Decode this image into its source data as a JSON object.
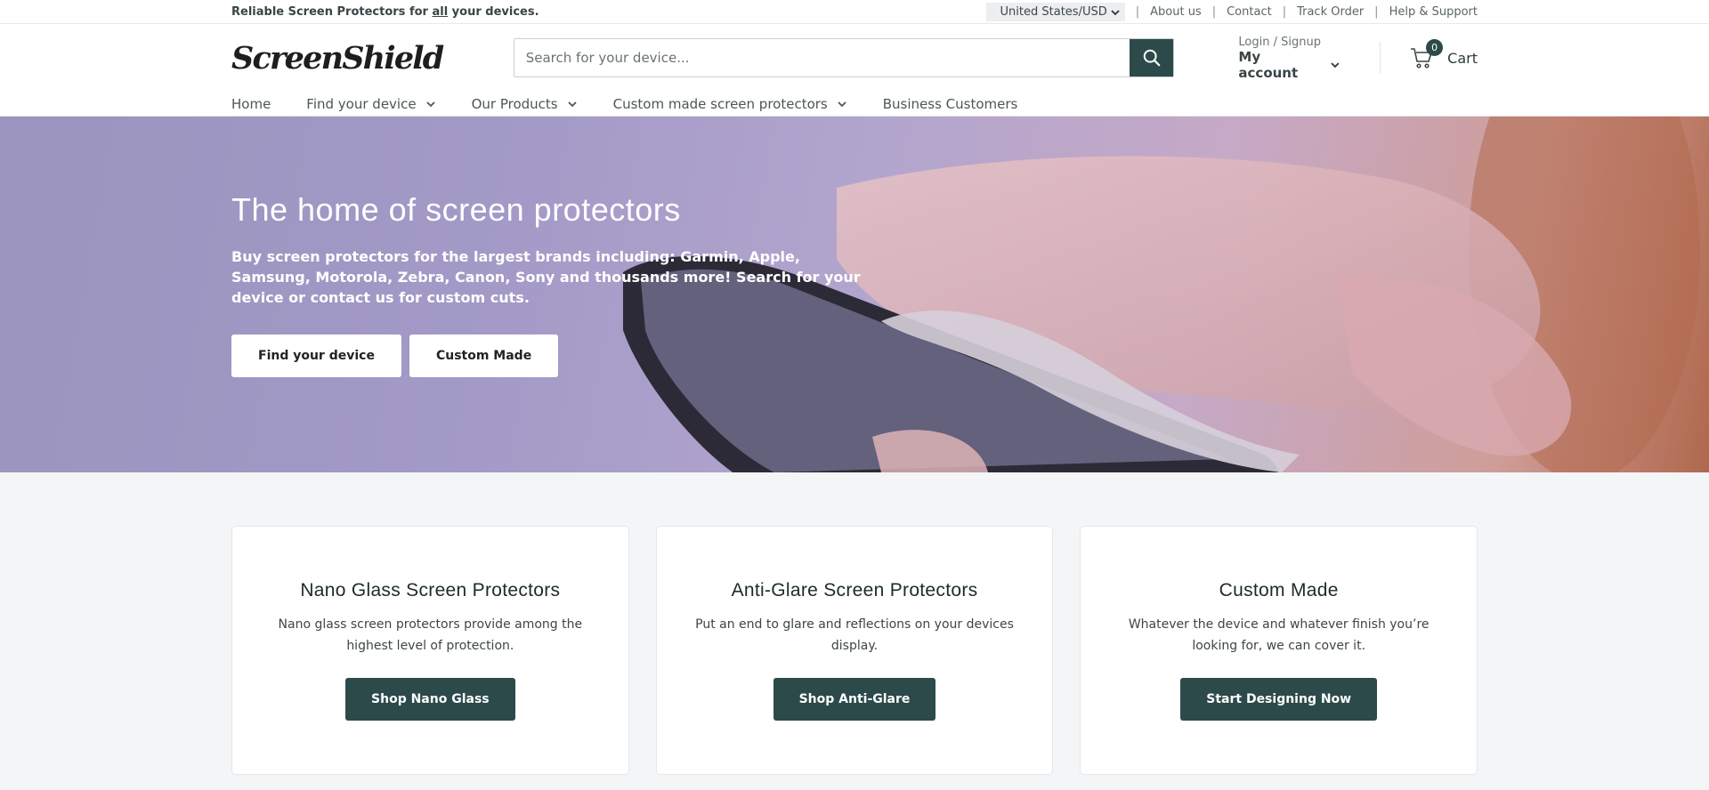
{
  "topbar": {
    "tagline_prefix": "Reliable Screen Protectors for ",
    "tagline_emph": "all",
    "tagline_suffix": " your devices.",
    "currency": "United States/USD",
    "links": [
      "About us",
      "Contact",
      "Track Order",
      "Help & Support"
    ]
  },
  "header": {
    "logo": "ScreenShield",
    "search_placeholder": "Search for your device...",
    "account_small": "Login / Signup",
    "account_big": "My account",
    "cart_count": "0",
    "cart_label": "Cart"
  },
  "nav": {
    "items": [
      {
        "label": "Home"
      },
      {
        "label": "Find your device"
      },
      {
        "label": "Our Products"
      },
      {
        "label": "Custom made screen protectors"
      },
      {
        "label": "Business Customers"
      }
    ]
  },
  "hero": {
    "title": "The home of screen protectors",
    "text": "Buy screen protectors for the largest brands including: Garmin, Apple, Samsung, Motorola, Zebra, Canon, Sony and thousands more! Search for your device or contact us for custom cuts.",
    "btn_find": "Find your device",
    "btn_custom": "Custom Made"
  },
  "cards": [
    {
      "title": "Nano Glass Screen Protectors",
      "text": "Nano glass screen protectors provide among the highest level of protection.",
      "button": "Shop Nano Glass"
    },
    {
      "title": "Anti-Glare Screen Protectors",
      "text": "Put an end to glare and reflections on your devices display.",
      "button": "Shop Anti-Glare"
    },
    {
      "title": "Custom Made",
      "text": "Whatever the device and whatever finish you’re looking for, we can cover it.",
      "button": "Start Designing Now"
    }
  ],
  "colors": {
    "brand": "#2d4a4a",
    "page_bg": "#f3f5f6"
  }
}
